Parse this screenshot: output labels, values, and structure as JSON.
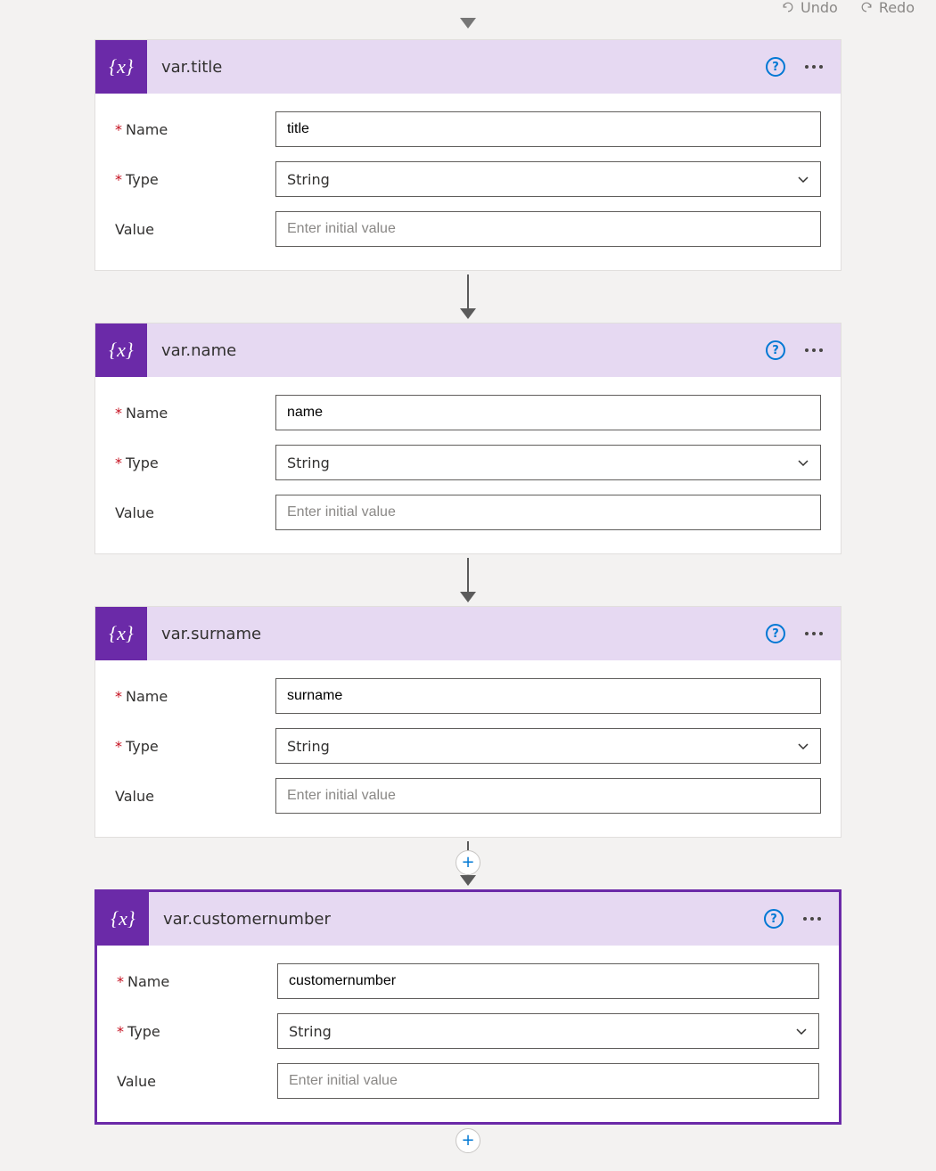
{
  "toolbar": {
    "undo": "Undo",
    "redo": "Redo"
  },
  "labels": {
    "name": "Name",
    "type": "Type",
    "value": "Value",
    "value_placeholder": "Enter initial value"
  },
  "cards": [
    {
      "title": "var.title",
      "name_value": "title",
      "type_value": "String",
      "selected": false,
      "plus_before": false
    },
    {
      "title": "var.name",
      "name_value": "name",
      "type_value": "String",
      "selected": false,
      "plus_before": false
    },
    {
      "title": "var.surname",
      "name_value": "surname",
      "type_value": "String",
      "selected": false,
      "plus_before": false
    },
    {
      "title": "var.customernumber",
      "name_value": "customernumber",
      "type_value": "String",
      "selected": true,
      "plus_before": true
    }
  ]
}
